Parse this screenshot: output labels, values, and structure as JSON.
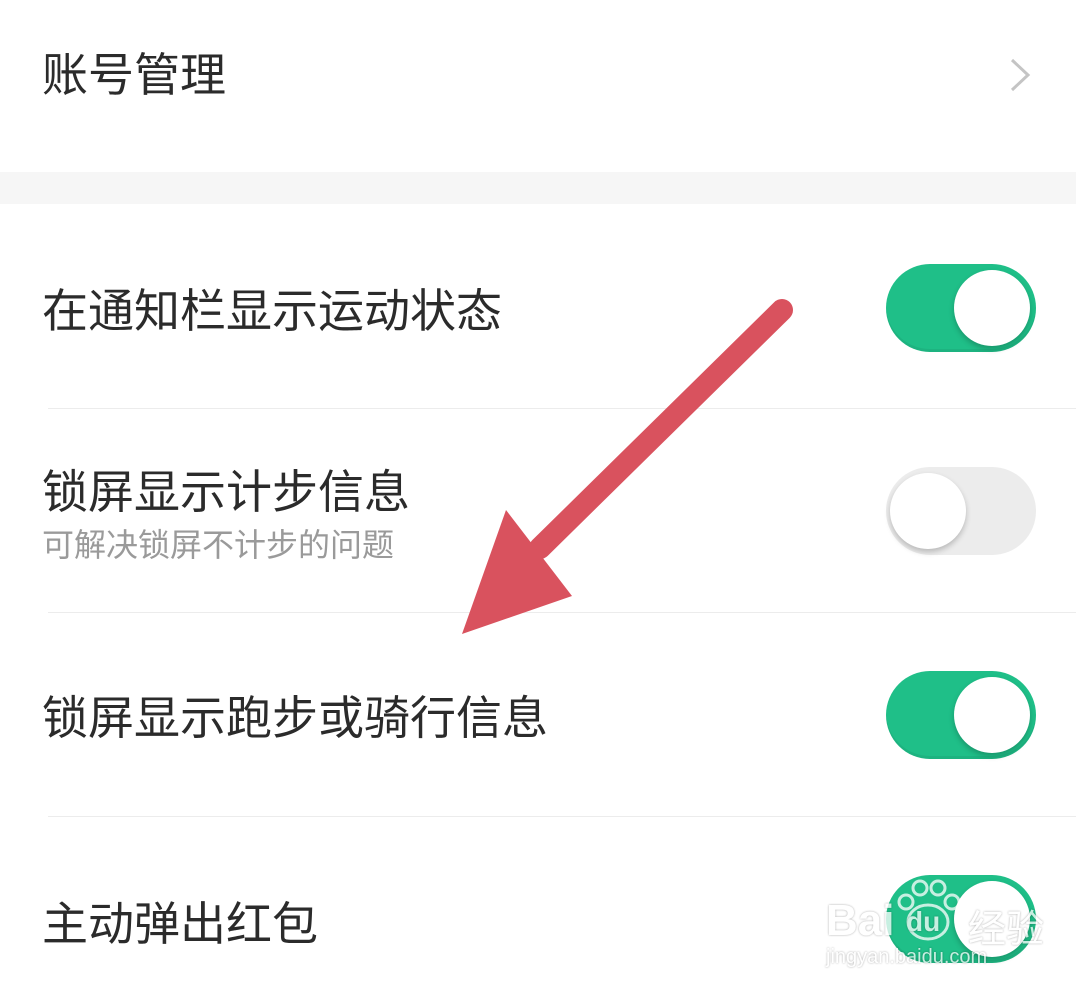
{
  "account_row": {
    "label": "账号管理",
    "chevron_icon": "chevron-right-icon"
  },
  "settings": [
    {
      "label": "在通知栏显示运动状态",
      "sublabel": "",
      "enabled": true
    },
    {
      "label": "锁屏显示计步信息",
      "sublabel": "可解决锁屏不计步的问题",
      "enabled": false
    },
    {
      "label": "锁屏显示跑步或骑行信息",
      "sublabel": "",
      "enabled": true
    },
    {
      "label": "主动弹出红包",
      "sublabel": "",
      "enabled": true
    }
  ],
  "colors": {
    "toggle_on": "#1fbf88",
    "toggle_off": "#ececec",
    "arrow": "#d9525e"
  },
  "annotation": {
    "icon": "red-arrow-icon"
  },
  "watermark": {
    "brand": "Bai",
    "logo_text": "du",
    "suffix": "经验",
    "url": "jingyan.baidu.com"
  }
}
